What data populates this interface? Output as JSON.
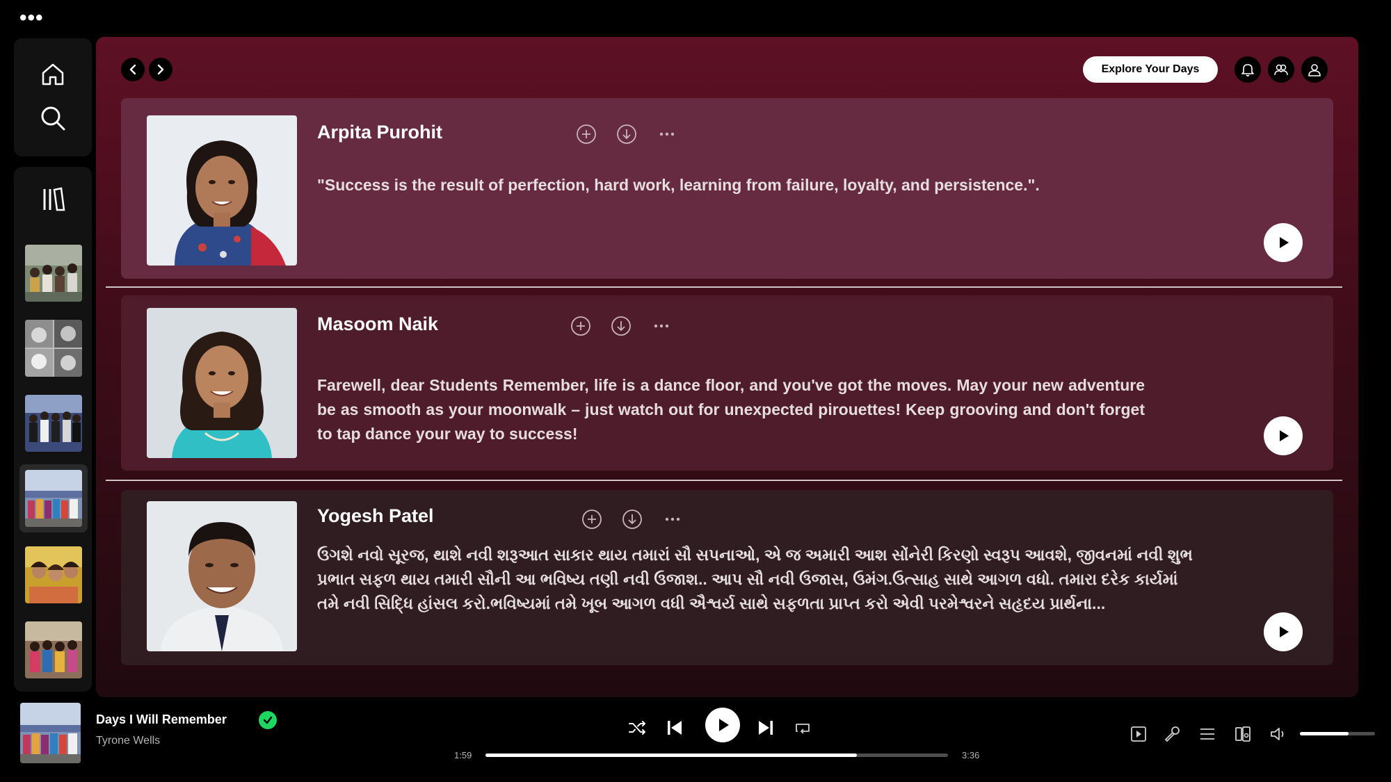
{
  "window": {
    "menu_icon": "more-dots-icon"
  },
  "sidebar": {
    "nav": [
      {
        "icon": "home-icon"
      },
      {
        "icon": "search-icon"
      }
    ],
    "library_icon": "library-icon",
    "playlists": [
      {
        "icon": "group-photo-thumbnail"
      },
      {
        "icon": "collage-thumbnail"
      },
      {
        "icon": "group-photo-thumbnail"
      },
      {
        "icon": "group-photo-thumbnail",
        "active": true
      },
      {
        "icon": "group-photo-thumbnail"
      },
      {
        "icon": "group-photo-thumbnail"
      }
    ]
  },
  "header": {
    "back_icon": "chevron-left-icon",
    "forward_icon": "chevron-right-icon",
    "explore_label": "Explore Your Days",
    "icons": [
      "bell-icon",
      "friends-icon",
      "user-icon"
    ]
  },
  "cards": [
    {
      "name": "Arpita Purohit",
      "quote": "\"Success is the result of perfection, hard work, learning from failure, loyalty, and persistence.\"."
    },
    {
      "name": "Masoom Naik",
      "quote": "Farewell, dear Students Remember, life is a dance floor, and you've got the moves. May your new adventure be as smooth as your moonwalk – just watch out for unexpected pirouettes! Keep grooving and don't forget to tap dance your way to success!"
    },
    {
      "name": "Yogesh Patel",
      "quote": "ઉગશે નવો સૂરજ, થાશે નવી શરૂઆત સાકાર થાય તમારાં સૌ સપનાઓ, એ જ અમારી આશ સોંનેરી કિરણો સ્વરૂપ આવશે, જીવનમાં નવી શુભ પ્રભાત સફળ થાય તમારી સૌની આ ભવિષ્ય તણી નવી ઉજાશ.. આપ સૌ નવી ઉજાસ, ઉમંગ.ઉત્સાહ સાથે આગળ વધો. તમારા દરેક કાર્યમાં તમે નવી સિદ્ધિ હાંસલ કરો.ભવિષ્યમાં તમે ખૂબ આગળ વધી ઐશ્વર્ય સાથે સફળતા પ્રાપ્ત કરો એવી પરમેશ્વરને સહૃદય પ્રાર્થના..."
    }
  ],
  "player": {
    "title": "Days I Will Remember",
    "artist": "Tyrone Wells",
    "elapsed": "1:59",
    "duration": "3:36",
    "progress": 0.803,
    "volume": 0.65,
    "accent": "#1ed760",
    "right_icons": [
      "now-playing-view-icon",
      "lyrics-icon",
      "queue-icon",
      "connect-device-icon",
      "volume-icon"
    ]
  },
  "colors": {
    "panel_top": "#5e1024",
    "card_bg": "#662a3e"
  }
}
